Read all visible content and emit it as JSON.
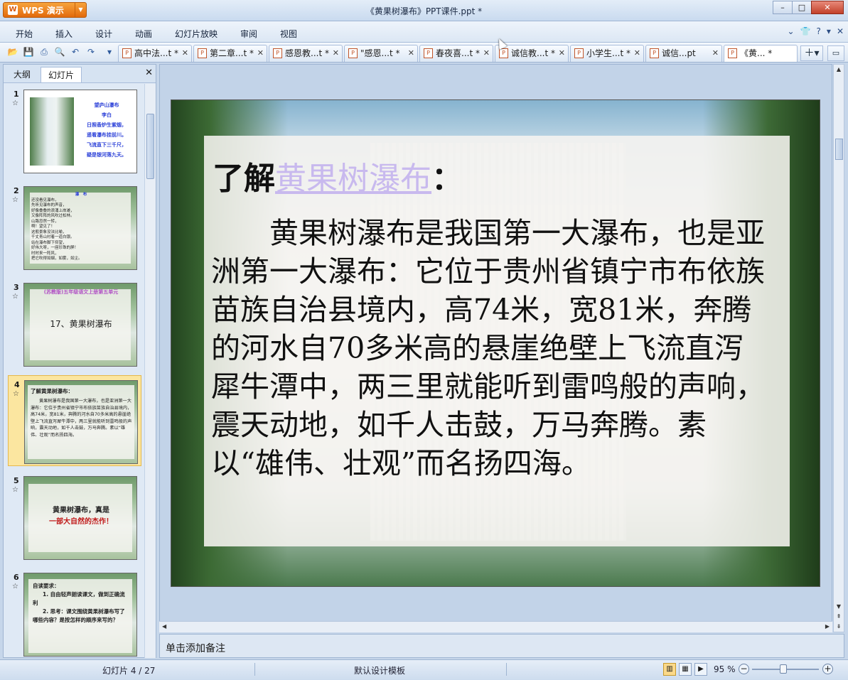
{
  "app": {
    "name": "WPS 演示",
    "window_title": "《黄果树瀑布》PPT课件.ppt *"
  },
  "menu": [
    "开始",
    "插入",
    "设计",
    "动画",
    "幻灯片放映",
    "审阅",
    "视图"
  ],
  "doc_tabs": [
    {
      "label": "高中法...t *"
    },
    {
      "label": "第二章...t *"
    },
    {
      "label": "感恩教...t *"
    },
    {
      "label": "\"感恩...t *"
    },
    {
      "label": "春夜喜...t *"
    },
    {
      "label": "诚信教...t *"
    },
    {
      "label": "小学生...t *"
    },
    {
      "label": "诚信...pt"
    },
    {
      "label": "《黄... *"
    }
  ],
  "left_panel": {
    "tabs": [
      "大纲",
      "幻灯片"
    ],
    "slides": [
      {
        "num": "1",
        "lines": [
          "望庐山瀑布",
          "李白",
          "日照香炉生紫烟，",
          "遥看瀑布挂前川。",
          "飞流直下三千尺，",
          "疑是银河落九天。"
        ]
      },
      {
        "num": "2",
        "lines": [
          "瀑　布",
          "还没看见瀑布，",
          "先听见瀑布的声音，",
          "好像叠叠的浪涌上岸滩，",
          "又像阵阵的风吹过松林。",
          "山路忽然一转，",
          "啊！望见了！",
          "这般景象没法比喻，",
          "千丈青山衬着一道白银。",
          "站在瀑布脚下仰望，",
          "好伟大呀，一座珍珠的屏！",
          "时时来一阵风，",
          "把它吹得如烟，如雾，如尘。"
        ]
      },
      {
        "num": "3",
        "lines": [
          "(苏教版)五年级语文上册第五单元",
          "17、黄果树瀑布"
        ]
      },
      {
        "num": "4",
        "lines": [
          "了解黄果树瀑布：",
          "黄果树瀑布是我国第一大瀑布，也是亚洲第一大瀑布：它位于贵州省镇宁市布依族苗族自治县境内，高74米，宽81米，奔腾的河水自70多米高的悬崖绝壁上飞流直泻犀牛潭中，两三里就能听到雷鸣般的声响，震天动地，如千人击鼓，万马奔腾。素以“雄伟、壮观”而名扬四海。"
        ]
      },
      {
        "num": "5",
        "lines": [
          "黄果树瀑布，真是",
          "一部大自然的杰作！"
        ]
      },
      {
        "num": "6",
        "lines": [
          "自读要求：",
          "1. 自由轻声朗读课文，做到正确流利",
          "2. 思考：课文围绕黄果树瀑布写了哪些内容？是按怎样的顺序来写的？"
        ]
      }
    ]
  },
  "slide": {
    "heading_prefix": "了解",
    "heading_link": "黄果树瀑布",
    "heading_suffix": "：",
    "body": "黄果树瀑布是我国第一大瀑布，也是亚洲第一大瀑布：它位于贵州省镇宁市布依族苗族自治县境内，高74米，宽81米，奔腾的河水自70多米高的悬崖绝壁上飞流直泻犀牛潭中，两三里就能听到雷鸣般的声响，震天动地，如千人击鼓，万马奔腾。素以“雄伟、壮观”而名扬四海。"
  },
  "notes_placeholder": "单击添加备注",
  "status": {
    "slide_counter": "幻灯片 4 / 27",
    "template": "默认设计模板",
    "zoom": "95 %"
  },
  "colors": {
    "app_button": "#e26a0c",
    "selected_thumb": "#fbe6a0",
    "heading_link": "#c8b9ee"
  }
}
